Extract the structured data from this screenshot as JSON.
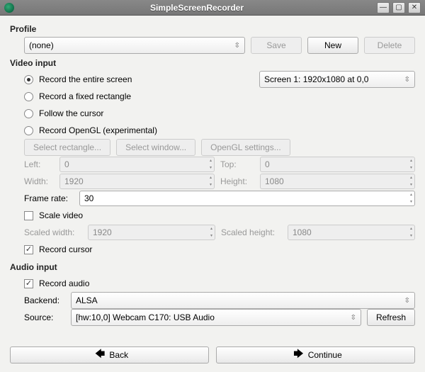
{
  "window": {
    "title": "SimpleScreenRecorder"
  },
  "profile": {
    "title": "Profile",
    "selected": "(none)",
    "save": "Save",
    "new": "New",
    "delete": "Delete"
  },
  "video": {
    "title": "Video input",
    "opt_entire": "Record the entire screen",
    "opt_rect": "Record a fixed rectangle",
    "opt_cursor": "Follow the cursor",
    "opt_opengl": "Record OpenGL (experimental)",
    "screen_selected": "Screen 1: 1920x1080 at 0,0",
    "btn_select_rect": "Select rectangle...",
    "btn_select_win": "Select window...",
    "btn_opengl_settings": "OpenGL settings...",
    "lbl_left": "Left:",
    "lbl_top": "Top:",
    "lbl_width": "Width:",
    "lbl_height": "Height:",
    "left": "0",
    "top": "0",
    "width": "1920",
    "height": "1080",
    "lbl_frame_rate": "Frame rate:",
    "frame_rate": "30",
    "scale_video": "Scale video",
    "lbl_scaled_w": "Scaled width:",
    "lbl_scaled_h": "Scaled height:",
    "scaled_w": "1920",
    "scaled_h": "1080",
    "record_cursor": "Record cursor"
  },
  "audio": {
    "title": "Audio input",
    "record_audio": "Record audio",
    "lbl_backend": "Backend:",
    "backend": "ALSA",
    "lbl_source": "Source:",
    "source": "[hw:10,0] Webcam C170: USB Audio",
    "refresh": "Refresh"
  },
  "nav": {
    "back": "Back",
    "continue": "Continue"
  }
}
